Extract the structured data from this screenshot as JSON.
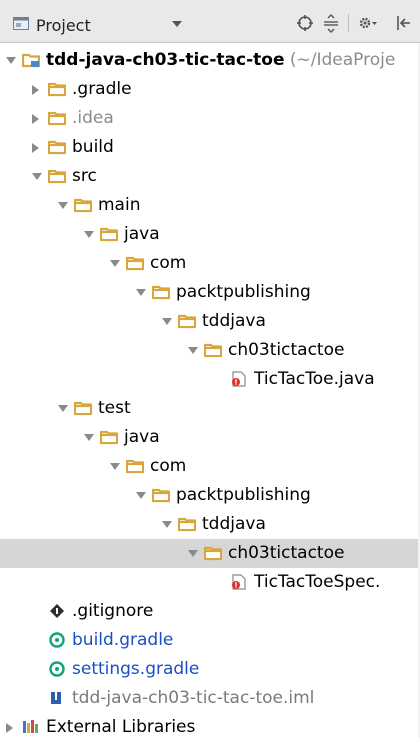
{
  "header": {
    "title": "Project",
    "icons": [
      "project-view-icon",
      "dropdown-caret-icon",
      "scroll-from-source-icon",
      "collapse-all-icon",
      "settings-icon",
      "hide-panel-icon"
    ]
  },
  "colors": {
    "folder": "#d8a63a",
    "root_folder_accent": "#4a86c8",
    "selected_row": "#d6d6d6",
    "gradle_icon": "#0fa37b",
    "java_error_badge": "#e0302c",
    "module_file_text": "#8c8c8c",
    "gradle_file_text": "#1a4fc2"
  },
  "tree": [
    {
      "label": "tdd-java-ch03-tic-tac-toe",
      "hint": " (~/IdeaProje",
      "icon": "module-folder-icon",
      "expanded": true,
      "bold": true
    },
    {
      "label": ".gradle",
      "icon": "folder-icon",
      "expanded": false
    },
    {
      "label": ".idea",
      "icon": "folder-icon",
      "expanded": false
    },
    {
      "label": "build",
      "icon": "folder-icon",
      "expanded": false
    },
    {
      "label": "src",
      "icon": "folder-icon",
      "expanded": true
    },
    {
      "label": "main",
      "icon": "folder-icon",
      "expanded": true
    },
    {
      "label": "java",
      "icon": "source-folder-icon",
      "expanded": true
    },
    {
      "label": "com",
      "icon": "folder-icon",
      "expanded": true
    },
    {
      "label": "packtpublishing",
      "icon": "folder-icon",
      "expanded": true
    },
    {
      "label": "tddjava",
      "icon": "folder-icon",
      "expanded": true
    },
    {
      "label": "ch03tictactoe",
      "icon": "folder-icon",
      "expanded": true
    },
    {
      "label": "TicTacToe.java",
      "icon": "java-file-error-icon"
    },
    {
      "label": "test",
      "icon": "folder-icon",
      "expanded": true
    },
    {
      "label": "java",
      "icon": "test-folder-icon",
      "expanded": true
    },
    {
      "label": "com",
      "icon": "folder-icon",
      "expanded": true
    },
    {
      "label": "packtpublishing",
      "icon": "folder-icon",
      "expanded": true
    },
    {
      "label": "tddjava",
      "icon": "folder-icon",
      "expanded": true
    },
    {
      "label": "ch03tictactoe",
      "icon": "folder-icon",
      "expanded": true,
      "selected": true
    },
    {
      "label": "TicTacToeSpec.",
      "icon": "java-file-error-icon"
    },
    {
      "label": ".gitignore",
      "icon": "gitignore-icon"
    },
    {
      "label": "build.gradle",
      "icon": "gradle-icon"
    },
    {
      "label": "settings.gradle",
      "icon": "gradle-icon"
    },
    {
      "label": "tdd-java-ch03-tic-tac-toe.iml",
      "icon": "iml-module-icon"
    },
    {
      "label": "External Libraries",
      "icon": "libraries-icon",
      "expanded": false
    }
  ]
}
